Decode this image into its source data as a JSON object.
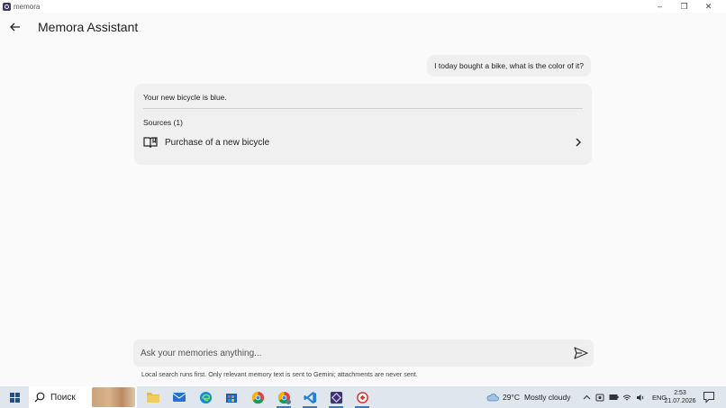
{
  "window": {
    "app_name": "memora",
    "controls": {
      "minimize": "–",
      "restore": "❐",
      "close": "✕"
    }
  },
  "header": {
    "title": "Memora Assistant",
    "back_icon": "arrow-left-icon"
  },
  "chat": {
    "user_message": "I today bought a bike, what is the color of it?",
    "answer": {
      "text": "Your new bicycle is blue.",
      "sources_label": "Sources (1)",
      "sources": [
        {
          "title": "Purchase of a new bicycle",
          "icon": "book-icon"
        }
      ]
    }
  },
  "composer": {
    "placeholder": "Ask your memories anything...",
    "value": "",
    "send_icon": "send-icon",
    "hint": "Local search runs first. Only relevant memory text is sent to Gemini; attachments are never sent."
  },
  "taskbar": {
    "search_placeholder": "Поиск",
    "weather": {
      "temp": "29°C",
      "condition": "Mostly cloudy"
    },
    "language": "ENG",
    "time": "2:53",
    "date": "21.07.2026",
    "apps": [
      "file-explorer-icon",
      "mail-icon",
      "edge-icon",
      "store-icon",
      "chrome-icon",
      "chrome-icon",
      "vscode-icon",
      "memora-icon",
      "app-icon"
    ],
    "accent_color": "#3b78c4"
  }
}
